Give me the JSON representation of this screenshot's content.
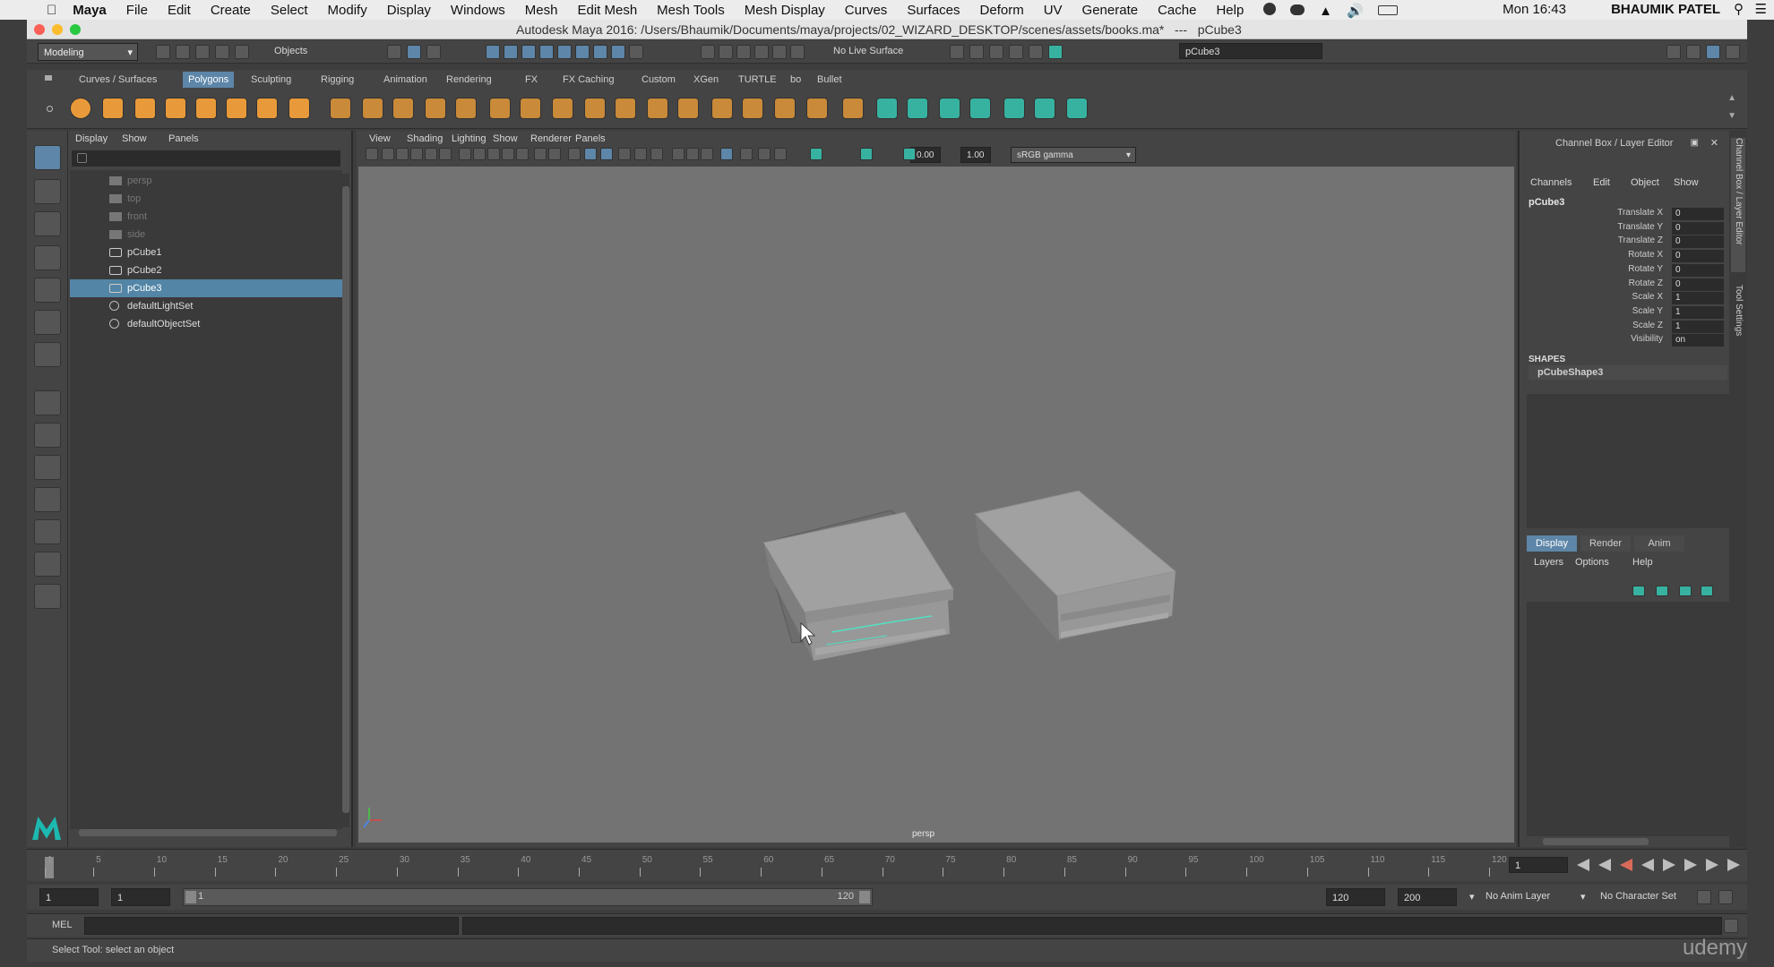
{
  "mac": {
    "app_name": "Maya",
    "menus": [
      "File",
      "Edit",
      "Create",
      "Select",
      "Modify",
      "Display",
      "Windows",
      "Mesh",
      "Edit Mesh",
      "Mesh Tools",
      "Mesh Display",
      "Curves",
      "Surfaces",
      "Deform",
      "UV",
      "Generate",
      "Cache",
      "Help"
    ],
    "clock": "Mon 16:43",
    "user": "BHAUMIK PATEL"
  },
  "window": {
    "title": "Autodesk Maya 2016: /Users/Bhaumik/Documents/maya/projects/02_WIZARD_DESKTOP/scenes/assets/books.ma*   ---   pCube3"
  },
  "statusline": {
    "menuset": "Modeling",
    "selection_mode": "Objects",
    "live_surface": "No Live Surface",
    "name_field": "pCube3"
  },
  "shelf": {
    "tabs": [
      "Curves / Surfaces",
      "Polygons",
      "Sculpting",
      "Rigging",
      "Animation",
      "Rendering",
      "FX",
      "FX Caching",
      "Custom",
      "XGen",
      "TURTLE",
      "bo",
      "Bullet"
    ],
    "active_tab": "Polygons"
  },
  "outliner": {
    "menus": [
      "Display",
      "Show",
      "Panels"
    ],
    "items": [
      {
        "label": "persp",
        "kind": "camera",
        "dim": true
      },
      {
        "label": "top",
        "kind": "camera",
        "dim": true
      },
      {
        "label": "front",
        "kind": "camera",
        "dim": true
      },
      {
        "label": "side",
        "kind": "camera",
        "dim": true
      },
      {
        "label": "pCube1",
        "kind": "mesh",
        "dim": false
      },
      {
        "label": "pCube2",
        "kind": "mesh",
        "dim": false
      },
      {
        "label": "pCube3",
        "kind": "mesh",
        "dim": false,
        "selected": true
      },
      {
        "label": "defaultLightSet",
        "kind": "set",
        "dim": false
      },
      {
        "label": "defaultObjectSet",
        "kind": "set",
        "dim": false
      }
    ]
  },
  "viewport": {
    "menus": [
      "View",
      "Shading",
      "Lighting",
      "Show",
      "Renderer",
      "Panels"
    ],
    "exposure": "0.00",
    "gamma": "1.00",
    "color_space": "sRGB gamma",
    "camera_label": "persp"
  },
  "channel_box": {
    "title": "Channel Box / Layer Editor",
    "menus": [
      "Channels",
      "Edit",
      "Object",
      "Show"
    ],
    "object": "pCube3",
    "attributes": [
      {
        "name": "Translate X",
        "value": "0"
      },
      {
        "name": "Translate Y",
        "value": "0"
      },
      {
        "name": "Translate Z",
        "value": "0"
      },
      {
        "name": "Rotate X",
        "value": "0"
      },
      {
        "name": "Rotate Y",
        "value": "0"
      },
      {
        "name": "Rotate Z",
        "value": "0"
      },
      {
        "name": "Scale X",
        "value": "1"
      },
      {
        "name": "Scale Y",
        "value": "1"
      },
      {
        "name": "Scale Z",
        "value": "1"
      },
      {
        "name": "Visibility",
        "value": "on"
      }
    ],
    "shapes_header": "SHAPES",
    "shape_name": "pCubeShape3",
    "layer_tabs": [
      "Display",
      "Render",
      "Anim"
    ],
    "layer_menus": [
      "Layers",
      "Options",
      "Help"
    ],
    "side_tabs": [
      "Channel Box / Layer Editor",
      "Tool Settings"
    ]
  },
  "timeline": {
    "ticks": [
      "1",
      "5",
      "10",
      "15",
      "20",
      "25",
      "30",
      "35",
      "40",
      "45",
      "50",
      "55",
      "60",
      "65",
      "70",
      "75",
      "80",
      "85",
      "90",
      "95",
      "100",
      "105",
      "110",
      "115",
      "120"
    ],
    "current_frame": "1"
  },
  "range": {
    "start": "1",
    "playback_start": "1",
    "slider_start": "1",
    "slider_end": "120",
    "playback_end": "120",
    "end": "200",
    "anim_layer": "No Anim Layer",
    "character_set": "No Character Set"
  },
  "cmdline": {
    "label": "MEL"
  },
  "help": {
    "text": "Select Tool: select an object"
  },
  "watermark": "udemy"
}
